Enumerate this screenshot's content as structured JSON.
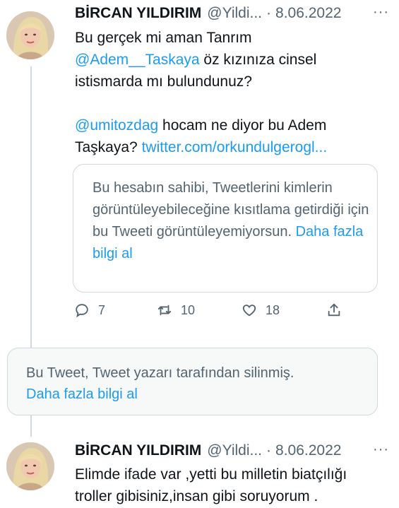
{
  "tweet1": {
    "name": "BİRCAN YILDIRIM",
    "handle": "@Yildi...",
    "separator": "·",
    "date": "8.06.2022",
    "more": "···",
    "line1": "Bu gerçek mi aman Tanrım",
    "mention1": "@Adem__Taskaya",
    "line2_rest": " öz kızınıza cinsel",
    "line3": "istismarda mı bulundunuz?",
    "mention2": "@umitozdag",
    "line4_rest": " hocam ne diyor bu Adem",
    "line5_start": "Taşkaya? ",
    "link": "twitter.com/orkundulgerogl..."
  },
  "quote": {
    "text": "Bu hesabın sahibi, Tweetlerini kimlerin görüntüleyebileceğine kısıtlama getirdiği için bu Tweeti görüntüleyemiyorsun. ",
    "learn_more": "Daha fazla bilgi al"
  },
  "actions": {
    "replies": "7",
    "retweets": "10",
    "likes": "18"
  },
  "deleted": {
    "text": "Bu Tweet, Tweet yazarı tarafından silinmiş.",
    "learn_more": "Daha fazla bilgi al"
  },
  "tweet2": {
    "name": "BİRCAN YILDIRIM",
    "handle": "@Yildi...",
    "separator": "·",
    "date": "8.06.2022",
    "more": "···",
    "line1": "Elimde ifade var ,yetti bu milletin biatçılığı",
    "line2": "troller gibisiniz,insan gibi soruyorum ."
  },
  "colors": {
    "accent": "#1d9bf0",
    "secondary_text": "#536471",
    "border": "#cfd9de"
  }
}
